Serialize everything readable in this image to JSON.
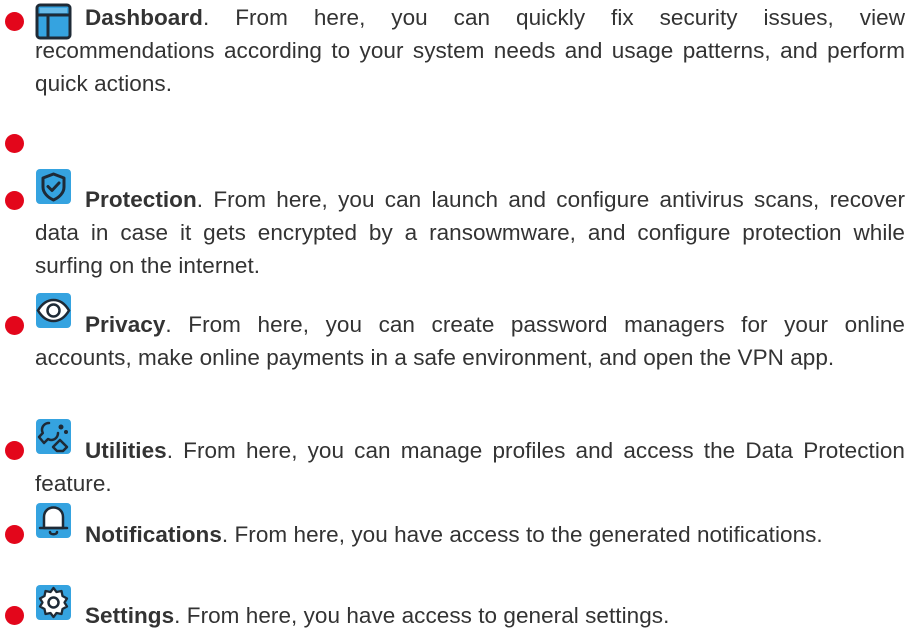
{
  "colors": {
    "bullet": "#e3061b",
    "icon_fill": "#35a3e0",
    "icon_stroke": "#1e2a36",
    "text": "#333333"
  },
  "items": [
    {
      "icon": "dashboard-icon",
      "title": "Dashboard",
      "text": ". From here, you can quickly fix security issues, view recommendations according to your system needs and usage patterns, and perform quick actions."
    },
    {
      "icon": "",
      "title": "",
      "text": ""
    },
    {
      "icon": "shield-icon",
      "title": "Protection",
      "text": ". From here, you can launch and configure antivirus scans, recover data in case it gets encrypted by a ransowmware, and configure protection while surfing on the internet."
    },
    {
      "icon": "eye-icon",
      "title": "Privacy",
      "text": ". From here, you can create password managers for your online accounts, make online payments in a safe environment, and open the VPN app."
    },
    {
      "icon": "utilities-icon",
      "title": "Utilities",
      "text": ". From here, you can manage profiles and access the Data Protection feature."
    },
    {
      "icon": "bell-icon",
      "title": "Notifications",
      "text": ". From here, you have access to the generated notifications."
    },
    {
      "icon": "gear-icon",
      "title": "Settings",
      "text": ". From here, you have access to general settings."
    }
  ]
}
